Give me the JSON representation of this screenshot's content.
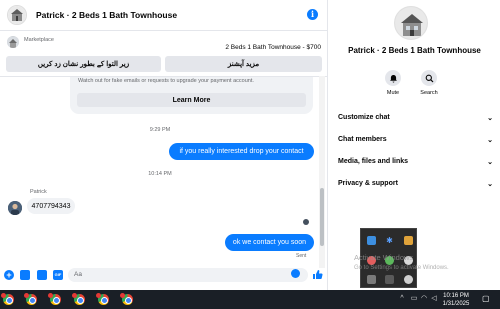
{
  "header": {
    "title": "Patrick · 2 Beds 1 Bath Townhouse",
    "info_icon": "info-icon"
  },
  "marketplace": {
    "label": "Marketplace",
    "listing": "2 Beds 1 Bath Townhouse - $700",
    "left_button": "زیر التوا کے بطور نشان زد کریں",
    "right_button": "مزید آپشنز"
  },
  "notice": {
    "text": "Watch out for fake emails or requests to upgrade your payment account.",
    "learn_more": "Learn More"
  },
  "messages": [
    {
      "kind": "timestamp",
      "text": "9:29 PM"
    },
    {
      "kind": "outgoing",
      "text": "if you really interested drop your contact"
    },
    {
      "kind": "timestamp",
      "text": "10:14 PM"
    },
    {
      "kind": "sender",
      "text": "Patrick"
    },
    {
      "kind": "incoming",
      "text": "4707794343"
    },
    {
      "kind": "outgoing",
      "text": "ok we contact you soon"
    },
    {
      "kind": "status",
      "text": "Sent"
    }
  ],
  "composer": {
    "placeholder": "Aa",
    "icons": [
      "plus-icon",
      "camera-icon",
      "image-icon",
      "gif-icon",
      "emoji-icon",
      "thumbs-up-icon"
    ]
  },
  "side_panel": {
    "title": "Patrick · 2 Beds 1 Bath Townhouse",
    "actions": [
      {
        "label": "Mute",
        "icon": "bell-icon"
      },
      {
        "label": "Search",
        "icon": "search-icon"
      }
    ],
    "sections": [
      {
        "label": "Customize chat"
      },
      {
        "label": "Chat members"
      },
      {
        "label": "Media, files and links"
      },
      {
        "label": "Privacy & support"
      }
    ]
  },
  "watermark": {
    "line1": "Activate Windows",
    "line2": "Go to Settings to activate Windows."
  },
  "taskbar": {
    "time": "10:16 PM",
    "date": "1/31/2025",
    "apps": [
      "chrome-icon",
      "chrome-icon",
      "chrome-icon",
      "chrome-icon",
      "chrome-icon",
      "chrome-icon"
    ]
  },
  "colors": {
    "accent": "#0a7cff",
    "bubble_in": "#f0f2f5",
    "button_bg": "#e4e6eb",
    "taskbar": "#1a1f26"
  }
}
